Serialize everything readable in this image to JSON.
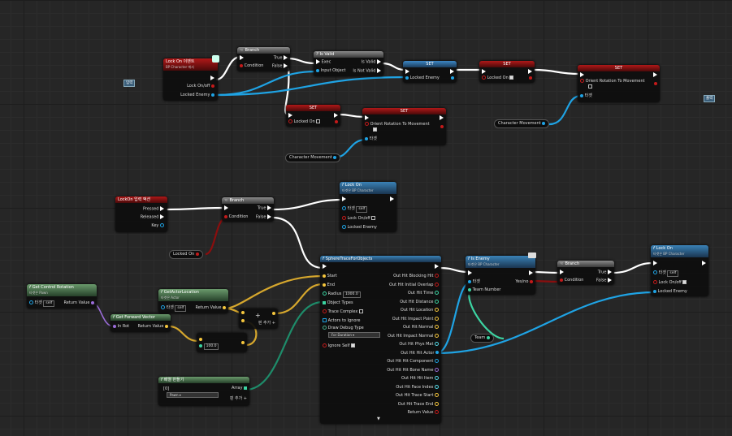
{
  "comments": {
    "left": "입력",
    "right": "출력"
  },
  "event_node": {
    "title": "Lock On 이벤트",
    "subtitle": "BP Character 에서",
    "pin_lockon": "Lock On/off",
    "pin_enemy": "Locked Enemy"
  },
  "branch1": {
    "title": "Branch",
    "condition": "Condition",
    "true": "True",
    "false": "False"
  },
  "isvalid": {
    "title": "Is Valid",
    "exec": "Exec",
    "is_valid": "Is Valid",
    "input": "Input Object",
    "not_valid": "Is Not Valid"
  },
  "set_enemy": {
    "title": "SET",
    "pin": "Locked Enemy"
  },
  "set_lockon1": {
    "title": "SET",
    "pin": "Locked On"
  },
  "set_orient1": {
    "title": "SET",
    "pin": "Orient Rotation To Movement",
    "target": "타겟"
  },
  "set_lockon2": {
    "title": "SET",
    "pin": "Locked On"
  },
  "set_orient2": {
    "title": "SET",
    "pin": "Orient Rotation To Movement",
    "target": "타겟"
  },
  "charmove": {
    "label1": "Character Movement",
    "label2": "Character Movement"
  },
  "input_action": {
    "title": "LockOn 입력 액션",
    "pressed": "Pressed",
    "released": "Released",
    "key": "Key"
  },
  "branch2": {
    "title": "Branch",
    "condition": "Condition",
    "true": "True",
    "false": "False"
  },
  "lockon_call1": {
    "title": "Lock On",
    "subtitle": "타겟은 BP Character",
    "target": "타겟",
    "self": "self",
    "lockon": "Lock On/off",
    "enemy": "Locked Enemy"
  },
  "locked_on_var": {
    "label": "Locked On"
  },
  "get_control_rot": {
    "title": "Get Control Rotation",
    "subtitle": "타겟은 Pawn",
    "target": "타겟",
    "self": "self",
    "ret": "Return Value"
  },
  "get_actor_loc": {
    "title": "GetActorLocation",
    "subtitle": "타겟은 Actor",
    "target": "타겟",
    "self": "self",
    "ret": "Return Value"
  },
  "get_forward": {
    "title": "Get Forward Vector",
    "in": "In Rot",
    "ret": "Return Value"
  },
  "add_node": {
    "plus": "+",
    "add_pin": "핀 추가"
  },
  "mul_node": {
    "value": "100.0"
  },
  "sphere": {
    "title": "SphereTraceForObjects",
    "start": "Start",
    "end": "End",
    "radius": "Radius",
    "radius_val": "1000.0",
    "object_types": "Object Types",
    "trace_complex": "Trace Complex",
    "actors_ignore": "Actors to Ignore",
    "draw_debug": "Draw Debug Type",
    "draw_val": "For Duration",
    "ignore_self": "Ignore Self",
    "outs": [
      "Out Hit Blocking Hit",
      "Out Hit Initial Overlap",
      "Out Hit Time",
      "Out Hit Distance",
      "Out Hit Location",
      "Out Hit Impact Point",
      "Out Hit Normal",
      "Out Hit Impact Normal",
      "Out Hit Phys Mat",
      "Out Hit Hit Actor",
      "Out Hit Hit Component",
      "Out Hit Hit Bone Name",
      "Out Hit Hit Item",
      "Out Hit Face Index",
      "Out Hit Trace Start",
      "Out Hit Trace End",
      "Return Value"
    ]
  },
  "make_array": {
    "title": "배열 만들기",
    "index": "[0]",
    "value": "Pawn",
    "array": "Array",
    "add_pin": "핀 추가"
  },
  "is_enemy": {
    "title": "Is Enemy",
    "subtitle": "타겟은 BP Character",
    "target": "타겟",
    "team": "Team Number",
    "yesno": "Yes/no"
  },
  "team_var": {
    "label": "Team"
  },
  "branch3": {
    "title": "Branch",
    "condition": "Condition",
    "true": "True",
    "false": "False"
  },
  "lockon_call2": {
    "title": "Lock On",
    "subtitle": "타겟은 BP Character",
    "target": "타겟",
    "self": "self",
    "lockon": "Lock On/off",
    "enemy": "Locked Enemy"
  },
  "colors": {
    "exec": "#ffffff",
    "object": "#1fa3e4",
    "bool": "#c41a1a",
    "vector": "#f5c63d",
    "float": "#3cd4a2",
    "rotator": "#9a6cd8"
  }
}
